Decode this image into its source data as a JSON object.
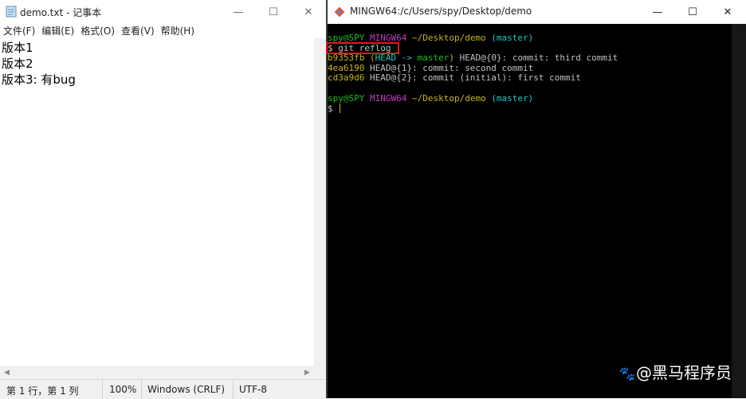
{
  "notepad": {
    "title": "demo.txt - 记事本",
    "menu": [
      "文件(F)",
      "编辑(E)",
      "格式(O)",
      "查看(V)",
      "帮助(H)"
    ],
    "lines": [
      "版本1",
      "版本2",
      "版本3: 有bug"
    ],
    "status": {
      "position": "第 1 行，第 1 列",
      "zoom": "100%",
      "line_ending": "Windows (CRLF)",
      "encoding": "UTF-8"
    },
    "controls": {
      "minimize": "—",
      "maximize": "☐",
      "close": "✕"
    }
  },
  "terminal": {
    "title": "MINGW64:/c/Users/spy/Desktop/demo",
    "controls": {
      "minimize": "—",
      "maximize": "☐",
      "close": "✕"
    },
    "prompt1": {
      "user": "spy@SPY",
      "env": "MINGW64",
      "path": "~/Desktop/demo",
      "branch": "(master)"
    },
    "command": "$ git reflog",
    "reflog": [
      {
        "hash": "b9353fb",
        "refs_open": "(",
        "head": "HEAD",
        "arrow": " -> ",
        "branch": "master",
        "refs_close": ")",
        "text": " HEAD@{0}: commit: third commit"
      },
      {
        "hash": "4ea6190",
        "text": " HEAD@{1}: commit: second commit"
      },
      {
        "hash": "cd3a9d6",
        "text": " HEAD@{2}: commit (initial): first commit"
      }
    ],
    "prompt2": {
      "user": "spy@SPY",
      "env": "MINGW64",
      "path": "~/Desktop/demo",
      "branch": "(master)"
    },
    "prompt_symbol": "$"
  },
  "watermark": "@黑马程序员",
  "colors": {
    "prompt_user": "#1ec11e",
    "prompt_env": "#c23bbf",
    "prompt_path": "#c8b41c",
    "prompt_branch": "#27c4c4",
    "highlight_box": "#e01818"
  }
}
